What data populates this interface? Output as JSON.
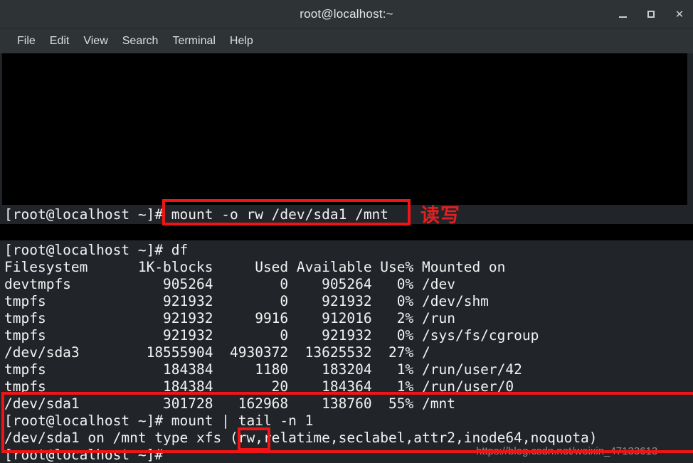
{
  "window": {
    "title": "root@localhost:~",
    "controls": [
      {
        "name": "minimize",
        "label": "_"
      },
      {
        "name": "maximize",
        "label": "□"
      },
      {
        "name": "close",
        "label": "✕"
      }
    ]
  },
  "menubar": {
    "items": [
      {
        "label": "File"
      },
      {
        "label": "Edit"
      },
      {
        "label": "View"
      },
      {
        "label": "Search"
      },
      {
        "label": "Terminal"
      },
      {
        "label": "Help"
      }
    ]
  },
  "terminal": {
    "prompt": "[root@localhost ~]#",
    "section_one": {
      "command_line": "[root@localhost ~]# mount -o rw /dev/sda1 /mnt"
    },
    "section_two": {
      "lines": [
        "[root@localhost ~]# df",
        "Filesystem      1K-blocks     Used Available Use% Mounted on",
        "devtmpfs           905264        0    905264   0% /dev",
        "tmpfs              921932        0    921932   0% /dev/shm",
        "tmpfs              921932     9916    912016   2% /run",
        "tmpfs              921932        0    921932   0% /sys/fs/cgroup",
        "/dev/sda3        18555904  4930372  13625532  27% /",
        "tmpfs              184384     1180    183204   1% /run/user/42",
        "tmpfs              184384       20    184364   1% /run/user/0",
        "/dev/sda1          301728   162968    138760  55% /mnt",
        "[root@localhost ~]# mount | tail -n 1",
        "/dev/sda1 on /mnt type xfs (rw,relatime,seclabel,attr2,inode64,noquota)",
        "[root@localhost ~]#"
      ]
    }
  },
  "annotations": {
    "command_highlight_note": "读写",
    "boxes": [
      {
        "name": "mount-command-box"
      },
      {
        "name": "result-block-box"
      },
      {
        "name": "rw-flag-box"
      }
    ],
    "accent_color": "#f01414"
  },
  "watermark": {
    "text": "https://blog.csdn.net/weixin_47133613"
  }
}
